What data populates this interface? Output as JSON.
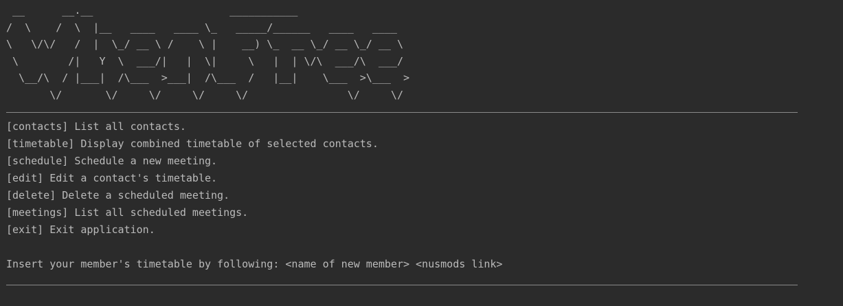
{
  "banner": " __      __.__                      ___________\n/  \\    /  \\  |__   ____   ____ \\_   _____/______   ____   ____\n\\   \\/\\/   /  |  \\_/ __ \\ /    \\ |    __) \\_  __ \\_/ __ \\_/ __ \\\n \\        /|   Y  \\  ___/|   |  \\|     \\   |  | \\/\\  ___/\\  ___/\n  \\__/\\  / |___|  /\\___  >___|  /\\___  /   |__|    \\___  >\\___  >\n       \\/       \\/     \\/     \\/     \\/                \\/     \\/",
  "menu": [
    {
      "cmd": "[contacts]",
      "desc": " List all contacts."
    },
    {
      "cmd": "[timetable]",
      "desc": " Display combined timetable of selected contacts."
    },
    {
      "cmd": "[schedule]",
      "desc": " Schedule a new meeting."
    },
    {
      "cmd": "[edit]",
      "desc": " Edit a contact's timetable."
    },
    {
      "cmd": "[delete]",
      "desc": " Delete a scheduled meeting."
    },
    {
      "cmd": "[meetings]",
      "desc": " List all scheduled meetings."
    },
    {
      "cmd": "[exit]",
      "desc": " Exit application."
    }
  ],
  "prompt": "Insert your member's timetable by following: <name of new member> <nusmods link>"
}
